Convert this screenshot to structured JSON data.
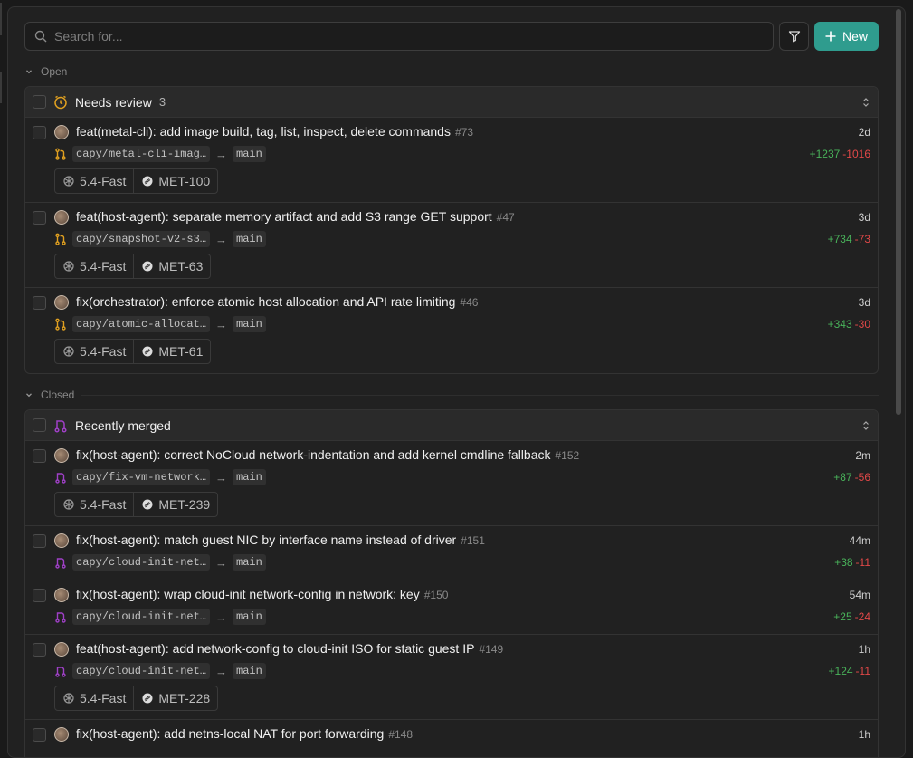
{
  "search": {
    "placeholder": "Search for..."
  },
  "new_button": {
    "label": "New"
  },
  "colors": {
    "accent": "#2f9c8e",
    "additions": "#49b25a",
    "deletions": "#e14848",
    "open_icon": "#e0a020",
    "merged_icon": "#a040c8"
  },
  "open": {
    "label": "Open",
    "group": {
      "title": "Needs review",
      "count": "3",
      "items": [
        {
          "title": "feat(metal-cli): add image build, tag, list, inspect, delete commands",
          "number": "#73",
          "age": "2d",
          "branch": "capy/metal-cli-imag…",
          "target": "main",
          "additions": "+1237",
          "deletions": "-1016",
          "model": "5.4-Fast",
          "ticket": "MET-100"
        },
        {
          "title": "feat(host-agent): separate memory artifact and add S3 range GET support",
          "number": "#47",
          "age": "3d",
          "branch": "capy/snapshot-v2-s3…",
          "target": "main",
          "additions": "+734",
          "deletions": "-73",
          "model": "5.4-Fast",
          "ticket": "MET-63"
        },
        {
          "title": "fix(orchestrator): enforce atomic host allocation and API rate limiting",
          "number": "#46",
          "age": "3d",
          "branch": "capy/atomic-allocat…",
          "target": "main",
          "additions": "+343",
          "deletions": "-30",
          "model": "5.4-Fast",
          "ticket": "MET-61"
        }
      ]
    }
  },
  "closed": {
    "label": "Closed",
    "group": {
      "title": "Recently merged",
      "items": [
        {
          "title": "fix(host-agent): correct NoCloud network-indentation and add kernel cmdline fallback",
          "number": "#152",
          "age": "2m",
          "branch": "capy/fix-vm-network…",
          "target": "main",
          "additions": "+87",
          "deletions": "-56",
          "model": "5.4-Fast",
          "ticket": "MET-239"
        },
        {
          "title": "fix(host-agent): match guest NIC by interface name instead of driver",
          "number": "#151",
          "age": "44m",
          "branch": "capy/cloud-init-net…",
          "target": "main",
          "additions": "+38",
          "deletions": "-11"
        },
        {
          "title": "fix(host-agent): wrap cloud-init network-config in network: key",
          "number": "#150",
          "age": "54m",
          "branch": "capy/cloud-init-net…",
          "target": "main",
          "additions": "+25",
          "deletions": "-24"
        },
        {
          "title": "feat(host-agent): add network-config to cloud-init ISO for static guest IP",
          "number": "#149",
          "age": "1h",
          "branch": "capy/cloud-init-net…",
          "target": "main",
          "additions": "+124",
          "deletions": "-11",
          "model": "5.4-Fast",
          "ticket": "MET-228"
        },
        {
          "title": "fix(host-agent): add netns-local NAT for port forwarding",
          "number": "#148",
          "age": "1h"
        }
      ]
    }
  }
}
